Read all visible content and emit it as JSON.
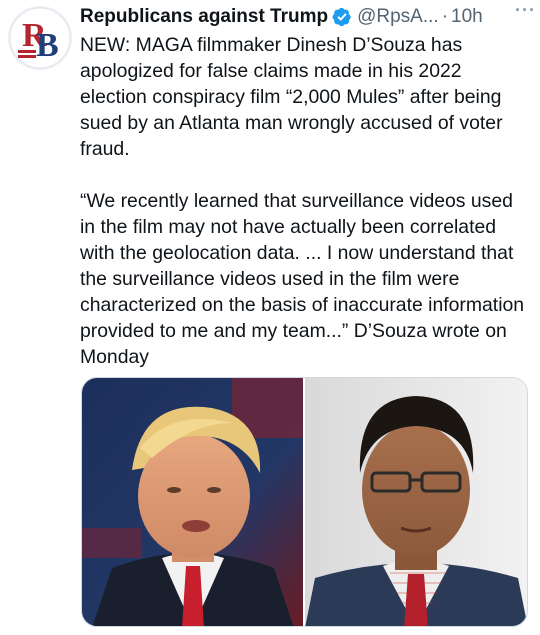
{
  "author": {
    "display_name": "Republicans against Trump",
    "handle": "@RpsA...",
    "verified_icon": "verified-badge-icon",
    "avatar_initials": "RB"
  },
  "meta": {
    "separator": "·",
    "time": "10h",
    "more_label": "···"
  },
  "tweet": {
    "paragraph_1": "NEW: MAGA filmmaker Dinesh D’Souza has apologized for false claims made in his 2022 election conspiracy film “2,000 Mules” after being sued by an Atlanta man wrongly accused of voter fraud.",
    "paragraph_2": "“We recently learned that surveillance videos used in the film may not have actually been correlated with the geolocation data. ... I now understand that the surveillance videos used in the film were characterized on the basis of inaccurate information provided to me and my team...” D’Souza wrote on Monday"
  },
  "colors": {
    "accent": "#1d9bf0",
    "text_primary": "#0f1419",
    "text_secondary": "#536471"
  }
}
